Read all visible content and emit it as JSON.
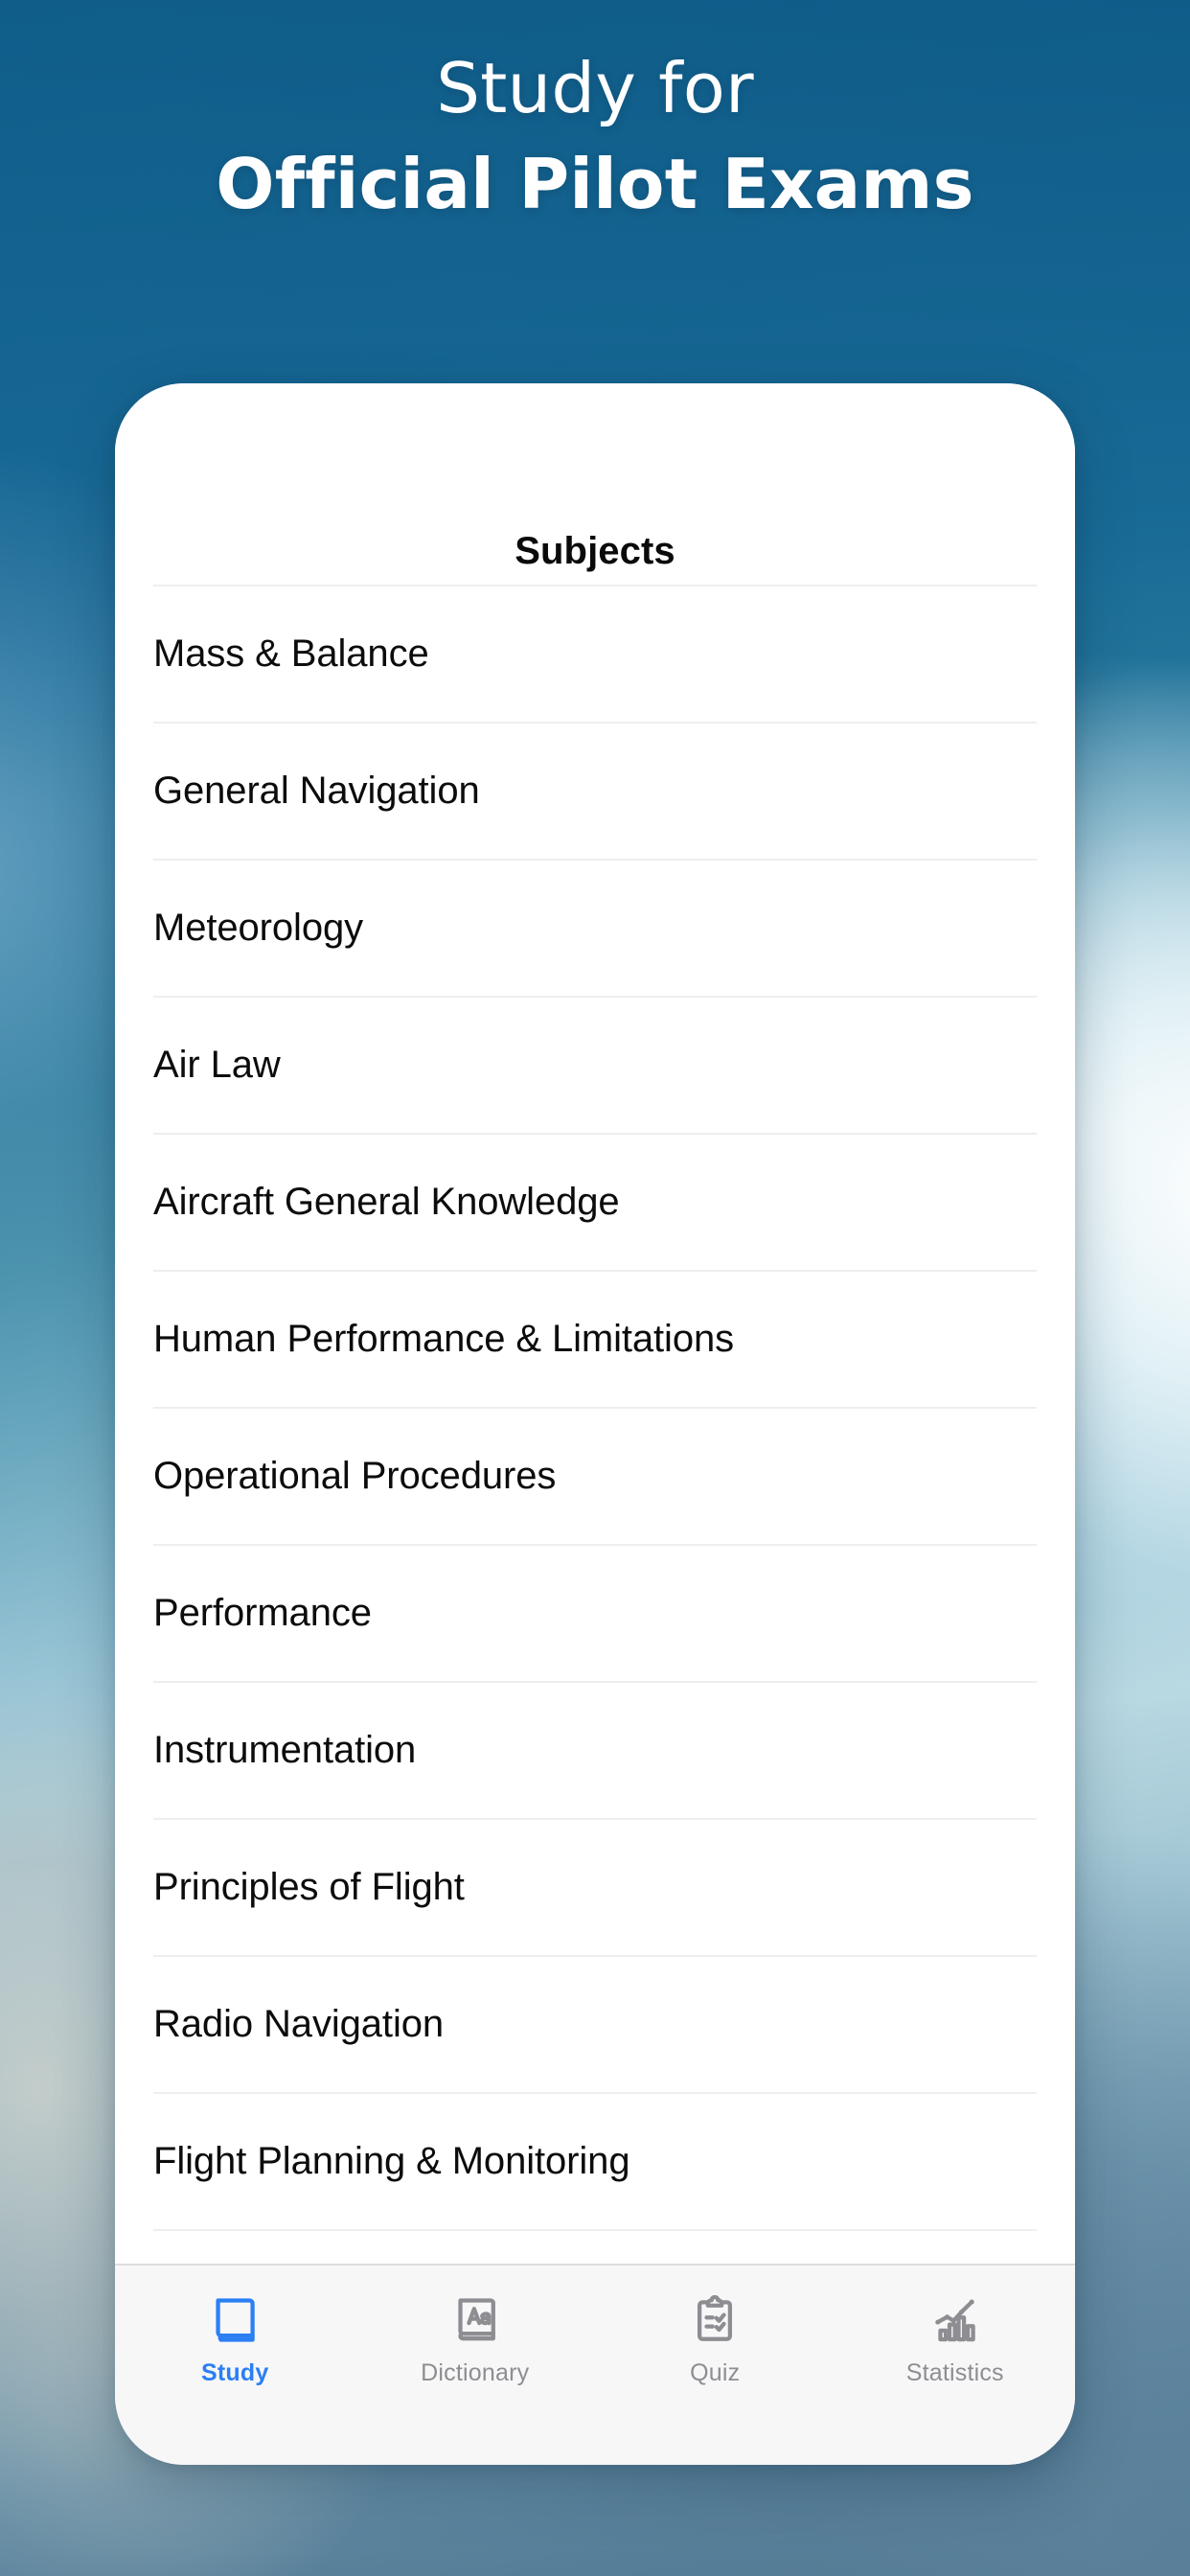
{
  "headline": {
    "line1": "Study for",
    "line2": "Official Pilot Exams"
  },
  "colors": {
    "background_top": "#13628f",
    "background_bottom": "#5c8199",
    "card": "#ffffff",
    "accent": "#2b7ff5",
    "tab_inactive": "#8d8d92",
    "tab_bar_background": "#f7f7f8",
    "divider": "#eceef0",
    "text_primary": "#0c0c0c"
  },
  "app": {
    "nav": {
      "title": "Subjects"
    },
    "subjects": [
      {
        "label": "Mass & Balance"
      },
      {
        "label": "General Navigation"
      },
      {
        "label": "Meteorology"
      },
      {
        "label": "Air Law"
      },
      {
        "label": "Aircraft General Knowledge"
      },
      {
        "label": "Human Performance & Limitations"
      },
      {
        "label": "Operational Procedures"
      },
      {
        "label": "Performance"
      },
      {
        "label": "Instrumentation"
      },
      {
        "label": "Principles of Flight"
      },
      {
        "label": "Radio Navigation"
      },
      {
        "label": "Flight Planning & Monitoring"
      }
    ],
    "tabs": [
      {
        "label": "Study",
        "icon": "book-icon",
        "active": true
      },
      {
        "label": "Dictionary",
        "icon": "dictionary-book-aa-icon",
        "active": false
      },
      {
        "label": "Quiz",
        "icon": "clipboard-checklist-icon",
        "active": false
      },
      {
        "label": "Statistics",
        "icon": "bar-chart-trend-icon",
        "active": false
      }
    ]
  }
}
